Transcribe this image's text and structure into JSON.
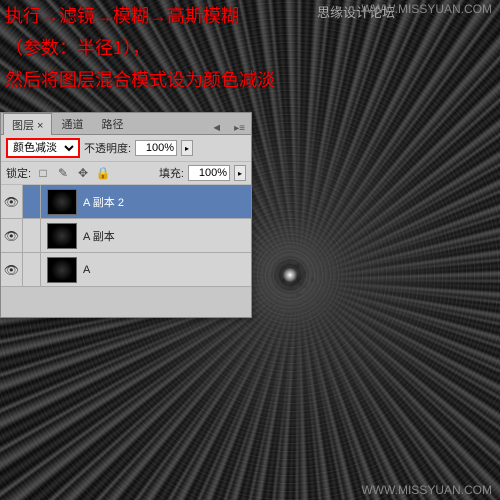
{
  "instructions": {
    "line1": "执行→滤镜→模糊→高斯模糊",
    "line2": "（参数：半径1），",
    "line3": "然后将图层混合模式设为颜色减淡"
  },
  "watermarks": {
    "top_right": "WWW.MISSYUAN.COM",
    "top_right2": "思缘设计论坛",
    "bottom_right": "WWW.MISSYUAN.COM"
  },
  "panel": {
    "tabs": {
      "layers": "图层 ×",
      "channels": "通道",
      "paths": "路径"
    },
    "blend_mode": "颜色减淡",
    "opacity_label": "不透明度:",
    "opacity_value": "100%",
    "lock_label": "锁定:",
    "fill_label": "填充:",
    "fill_value": "100%",
    "lock_icons": {
      "pixels": "□",
      "brush": "✎",
      "move": "✥",
      "all": "🔒"
    }
  },
  "layers": [
    {
      "name": "A 副本 2",
      "visible": true,
      "selected": true
    },
    {
      "name": "A 副本",
      "visible": true,
      "selected": false
    },
    {
      "name": "A",
      "visible": true,
      "selected": false
    }
  ]
}
